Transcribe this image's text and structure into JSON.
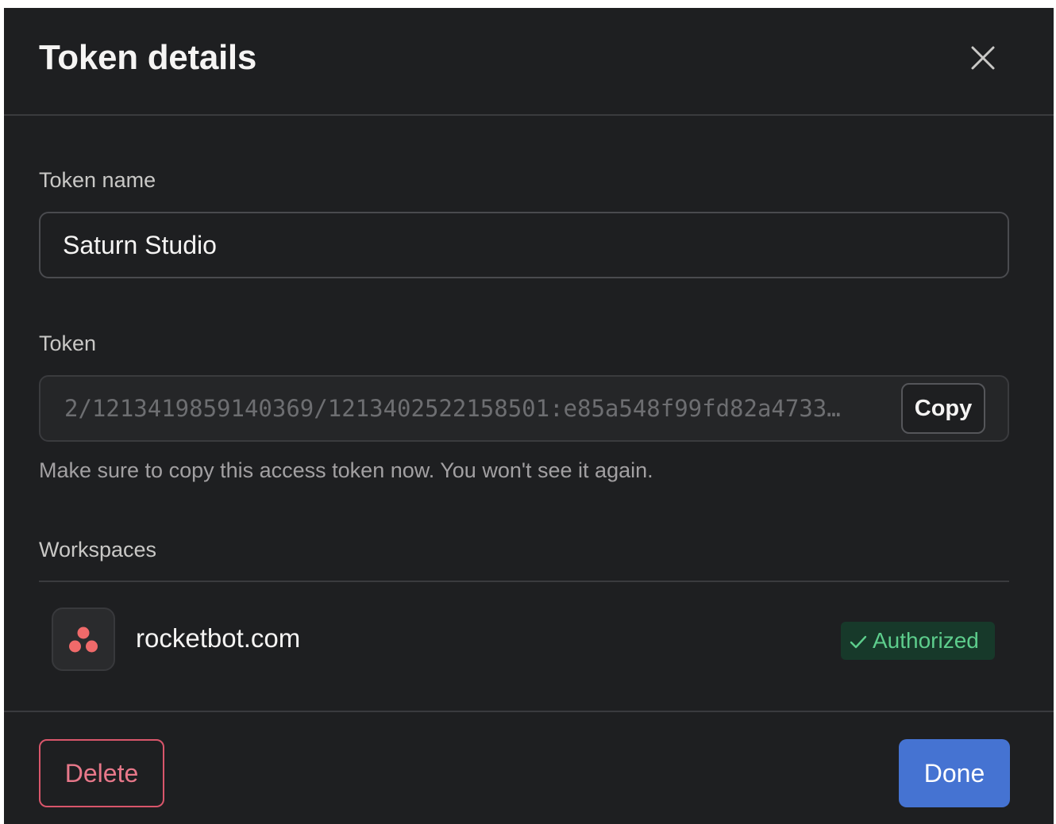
{
  "dialog": {
    "title": "Token details"
  },
  "token_name": {
    "label": "Token name",
    "value": "Saturn Studio"
  },
  "token": {
    "label": "Token",
    "value": "2/1213419859140369/1213402522158501:e85a548f99fd82a4733…",
    "copy_label": "Copy",
    "hint": "Make sure to copy this access token now. You won't see it again."
  },
  "workspaces": {
    "label": "Workspaces",
    "items": [
      {
        "name": "rocketbot.com",
        "status": "Authorized",
        "logo_icon": "asana-logo-icon",
        "logo_color": "#f06a6a"
      }
    ]
  },
  "footer": {
    "delete_label": "Delete",
    "done_label": "Done"
  },
  "colors": {
    "background": "#1e1f21",
    "accent": "#4573d2",
    "danger": "#d9566b",
    "success": "#5dcd8c",
    "success_bg": "#17392a"
  }
}
